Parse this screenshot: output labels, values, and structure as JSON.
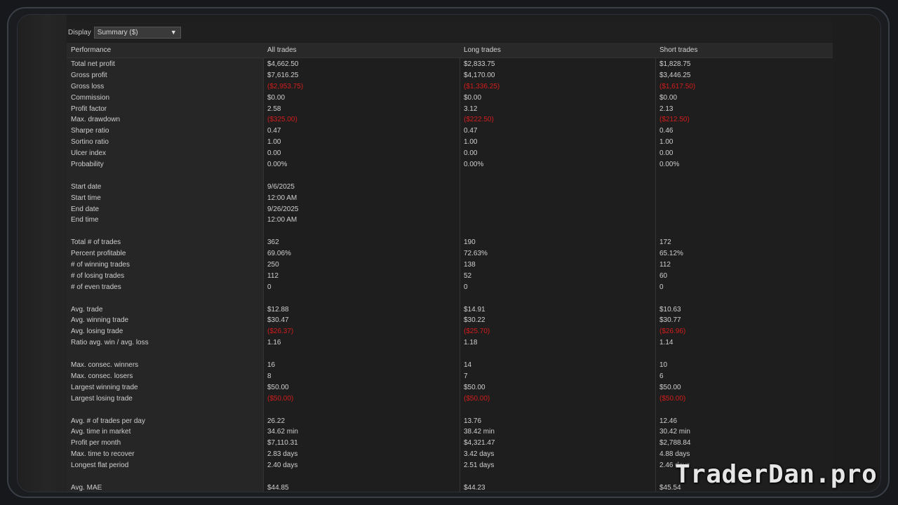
{
  "toolbar": {
    "display_label": "Display",
    "display_value": "Summary ($)"
  },
  "columns": [
    "Performance",
    "All trades",
    "Long trades",
    "Short trades"
  ],
  "colors": {
    "negative": "#d21c1c",
    "text": "#cfcfcf"
  },
  "rows": [
    {
      "label": "Total net profit",
      "all": "$4,662.50",
      "long": "$2,833.75",
      "short": "$1,828.75"
    },
    {
      "label": "Gross profit",
      "all": "$7,616.25",
      "long": "$4,170.00",
      "short": "$3,446.25"
    },
    {
      "label": "Gross loss",
      "all": "($2,953.75)",
      "long": "($1,336.25)",
      "short": "($1,617.50)",
      "negative": true
    },
    {
      "label": "Commission",
      "all": "$0.00",
      "long": "$0.00",
      "short": "$0.00"
    },
    {
      "label": "Profit factor",
      "all": "2.58",
      "long": "3.12",
      "short": "2.13"
    },
    {
      "label": "Max. drawdown",
      "all": "($325.00)",
      "long": "($222.50)",
      "short": "($212.50)",
      "negative": true
    },
    {
      "label": "Sharpe ratio",
      "all": "0.47",
      "long": "0.47",
      "short": "0.46"
    },
    {
      "label": "Sortino ratio",
      "all": "1.00",
      "long": "1.00",
      "short": "1.00"
    },
    {
      "label": "Ulcer index",
      "all": "0.00",
      "long": "0.00",
      "short": "0.00"
    },
    {
      "label": "Probability",
      "all": "0.00%",
      "long": "0.00%",
      "short": "0.00%"
    },
    {
      "label": "",
      "all": "",
      "long": "",
      "short": ""
    },
    {
      "label": "Start date",
      "all": "9/6/2025",
      "long": "",
      "short": ""
    },
    {
      "label": "Start time",
      "all": "12:00 AM",
      "long": "",
      "short": ""
    },
    {
      "label": "End date",
      "all": "9/26/2025",
      "long": "",
      "short": ""
    },
    {
      "label": "End time",
      "all": "12:00 AM",
      "long": "",
      "short": ""
    },
    {
      "label": "",
      "all": "",
      "long": "",
      "short": ""
    },
    {
      "label": "Total # of trades",
      "all": "362",
      "long": "190",
      "short": "172"
    },
    {
      "label": "Percent profitable",
      "all": "69.06%",
      "long": "72.63%",
      "short": "65.12%"
    },
    {
      "label": "# of winning trades",
      "all": "250",
      "long": "138",
      "short": "112"
    },
    {
      "label": "# of losing trades",
      "all": "112",
      "long": "52",
      "short": "60"
    },
    {
      "label": "# of even trades",
      "all": "0",
      "long": "0",
      "short": "0"
    },
    {
      "label": "",
      "all": "",
      "long": "",
      "short": ""
    },
    {
      "label": "Avg. trade",
      "all": "$12.88",
      "long": "$14.91",
      "short": "$10.63"
    },
    {
      "label": "Avg. winning trade",
      "all": "$30.47",
      "long": "$30.22",
      "short": "$30.77"
    },
    {
      "label": "Avg. losing trade",
      "all": "($26.37)",
      "long": "($25.70)",
      "short": "($26.96)",
      "negative": true
    },
    {
      "label": "Ratio avg. win / avg. loss",
      "all": "1.16",
      "long": "1.18",
      "short": "1.14"
    },
    {
      "label": "",
      "all": "",
      "long": "",
      "short": ""
    },
    {
      "label": "Max. consec. winners",
      "all": "16",
      "long": "14",
      "short": "10"
    },
    {
      "label": "Max. consec. losers",
      "all": "8",
      "long": "7",
      "short": "6"
    },
    {
      "label": "Largest winning trade",
      "all": "$50.00",
      "long": "$50.00",
      "short": "$50.00"
    },
    {
      "label": "Largest losing trade",
      "all": "($50.00)",
      "long": "($50.00)",
      "short": "($50.00)",
      "negative": true
    },
    {
      "label": "",
      "all": "",
      "long": "",
      "short": ""
    },
    {
      "label": "Avg. # of trades per day",
      "all": "26.22",
      "long": "13.76",
      "short": "12.46"
    },
    {
      "label": "Avg. time in market",
      "all": "34.62 min",
      "long": "38.42 min",
      "short": "30.42 min"
    },
    {
      "label": "Profit per month",
      "all": "$7,110.31",
      "long": "$4,321.47",
      "short": "$2,788.84"
    },
    {
      "label": "Max. time to recover",
      "all": "2.83 days",
      "long": "3.42 days",
      "short": "4.88 days"
    },
    {
      "label": "Longest flat period",
      "all": "2.40 days",
      "long": "2.51 days",
      "short": "2.46 days"
    },
    {
      "label": "",
      "all": "",
      "long": "",
      "short": ""
    },
    {
      "label": "Avg. MAE",
      "all": "$44.85",
      "long": "$44.23",
      "short": "$45.54"
    }
  ],
  "watermark": "TraderDan.pro"
}
